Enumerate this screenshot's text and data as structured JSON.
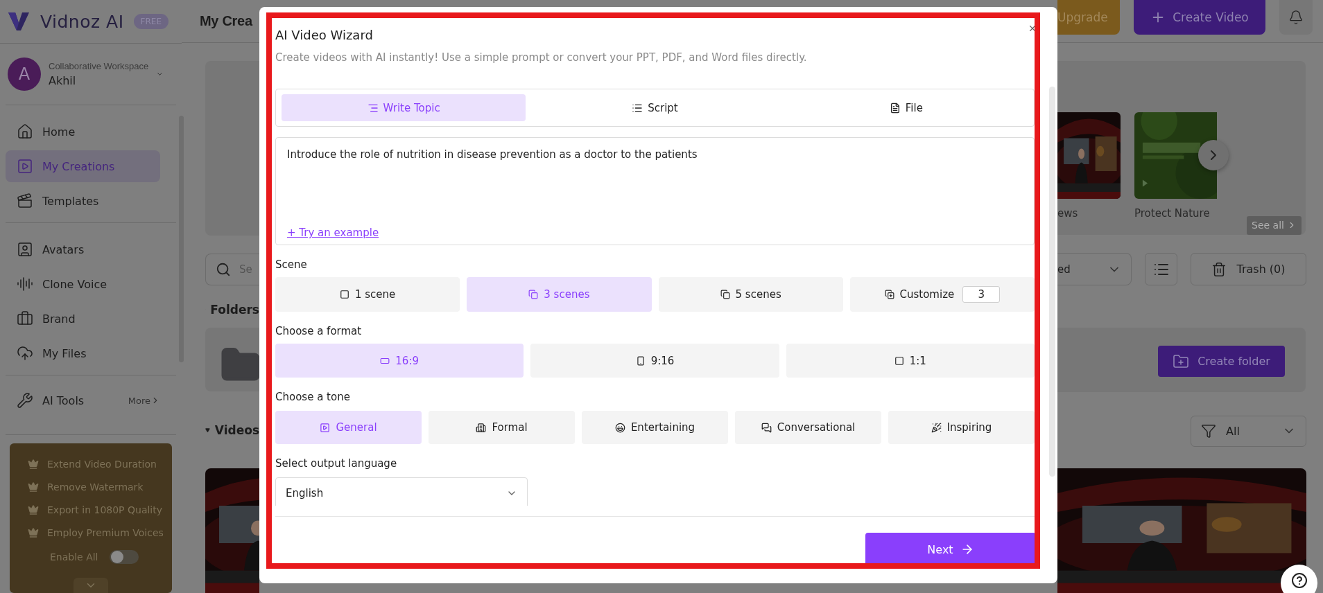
{
  "sidebar": {
    "logo": "Vidnoz AI",
    "plan_badge": "FREE",
    "workspace": {
      "avatar": "A",
      "label": "Collaborative Workspace",
      "name": "Akhil"
    },
    "nav_groups": [
      [
        {
          "label": "Home",
          "selected": false
        },
        {
          "label": "My Creations",
          "selected": true
        },
        {
          "label": "Templates",
          "selected": false
        }
      ],
      [
        {
          "label": "Avatars",
          "selected": false
        },
        {
          "label": "Clone Voice",
          "selected": false
        },
        {
          "label": "Brand",
          "selected": false
        },
        {
          "label": "My Files",
          "selected": false
        }
      ]
    ],
    "tools": {
      "label": "AI Tools",
      "more": "More"
    },
    "promo": {
      "features": [
        "Extend Video Duration",
        "Remove Watermark",
        "Export in 1080P Quality",
        "Employ Premium Voices"
      ],
      "toggle": {
        "label": "Enable All",
        "on": false
      }
    }
  },
  "header": {
    "title": "My Crea",
    "upgrade": "Upgrade",
    "create_video": "Create Video"
  },
  "banner": {
    "thumbnails": [
      {
        "caption": "ews",
        "kind": "picture"
      },
      {
        "caption": "Protect Nature",
        "kind": "picture"
      }
    ],
    "see_all": "See all"
  },
  "toolbar": {
    "search": {
      "placeholder": "Se"
    },
    "sort": {
      "value": "ed"
    },
    "trash": "Trash (0)"
  },
  "folders": {
    "title": "Folders",
    "create": "Create folder"
  },
  "videos": {
    "title": "Videos",
    "filter": {
      "value": "All"
    }
  },
  "wizard": {
    "title": "AI Video Wizard",
    "subtitle": "Create videos with AI instantly! Use a simple prompt or convert your PPT, PDF, and Word files directly.",
    "tabs": [
      {
        "label": "Write Topic",
        "selected": true
      },
      {
        "label": "Script",
        "selected": false
      },
      {
        "label": "File",
        "selected": false
      }
    ],
    "topic": {
      "value": "Introduce the role of nutrition in disease prevention as a doctor to the patients",
      "example_link": "+ Try an example"
    },
    "scene": {
      "label": "Scene",
      "options": [
        {
          "label": "1 scene",
          "selected": false,
          "kind": "preset"
        },
        {
          "label": "3 scenes",
          "selected": true,
          "kind": "preset"
        },
        {
          "label": "5 scenes",
          "selected": false,
          "kind": "preset"
        },
        {
          "label": "Customize",
          "selected": false,
          "kind": "custom",
          "value": "3"
        }
      ]
    },
    "format": {
      "label": "Choose a format",
      "options": [
        {
          "label": "16:9",
          "selected": true
        },
        {
          "label": "9:16",
          "selected": false
        },
        {
          "label": "1:1",
          "selected": false
        }
      ]
    },
    "tone": {
      "label": "Choose a tone",
      "options": [
        {
          "label": "General",
          "selected": true
        },
        {
          "label": "Formal",
          "selected": false
        },
        {
          "label": "Entertaining",
          "selected": false
        },
        {
          "label": "Conversational",
          "selected": false
        },
        {
          "label": "Inspiring",
          "selected": false
        }
      ]
    },
    "language": {
      "label": "Select output language",
      "value": "English"
    },
    "next": "Next"
  }
}
